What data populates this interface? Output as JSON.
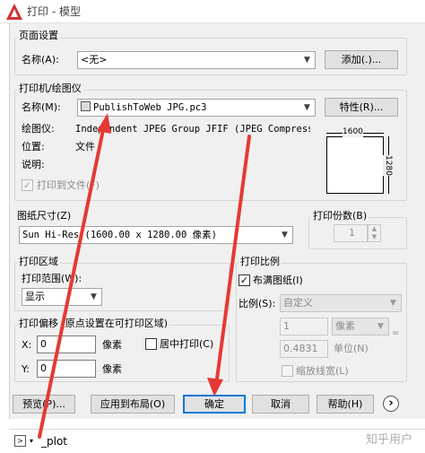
{
  "window": {
    "title": "打印 - 模型"
  },
  "page_setup": {
    "group_label": "页面设置",
    "name_label": "名称(A):",
    "name_value": "<无>",
    "add_button": "添加(.)..."
  },
  "printer": {
    "group_label": "打印机/绘图仪",
    "name_label": "名称(M):",
    "name_value": "PublishToWeb JPG.pc3",
    "properties_button": "特性(R)...",
    "plotter_label": "绘图仪:",
    "plotter_value": "Independent JPEG Group JFIF (JPEG Compressi...",
    "location_label": "位置:",
    "location_value": "文件",
    "description_label": "说明:",
    "plot_to_file_label": "打印到文件(F)",
    "plot_to_file_checked": true,
    "preview_width": "1600",
    "preview_height": "1280"
  },
  "paper_size": {
    "group_label": "图纸尺寸(Z)",
    "value": "Sun Hi-Res (1600.00 x 1280.00 像素)"
  },
  "copies": {
    "group_label": "打印份数(B)",
    "value": "1"
  },
  "plot_area": {
    "group_label": "打印区域",
    "what_label": "打印范围(W):",
    "what_value": "显示"
  },
  "plot_scale": {
    "group_label": "打印比例",
    "fit_label": "布满图纸(I)",
    "fit_checked": true,
    "scale_label": "比例(S):",
    "scale_value": "自定义",
    "value1": "1",
    "unit_value": "像素",
    "value2": "0.4831",
    "unit_label": "单位(N)",
    "scale_lineweights_label": "缩放线宽(L)",
    "scale_lineweights_checked": false
  },
  "plot_offset": {
    "group_label": "打印偏移 (原点设置在可打印区域)",
    "x_label": "X:",
    "x_value": "0",
    "x_unit": "像素",
    "y_label": "Y:",
    "y_value": "0",
    "y_unit": "像素",
    "center_label": "居中打印(C)",
    "center_checked": false
  },
  "buttons": {
    "preview": "预览(P)...",
    "apply_layout": "应用到布局(O)",
    "ok": "确定",
    "cancel": "取消",
    "help": "帮助(H)",
    "more": "›"
  },
  "command_line": {
    "text": "_plot"
  },
  "watermark": {
    "text": "知乎用户"
  },
  "colors": {
    "accent": "#0078d7",
    "annotation_arrow": "#e53935",
    "autocad_red": "#d32f2f"
  }
}
